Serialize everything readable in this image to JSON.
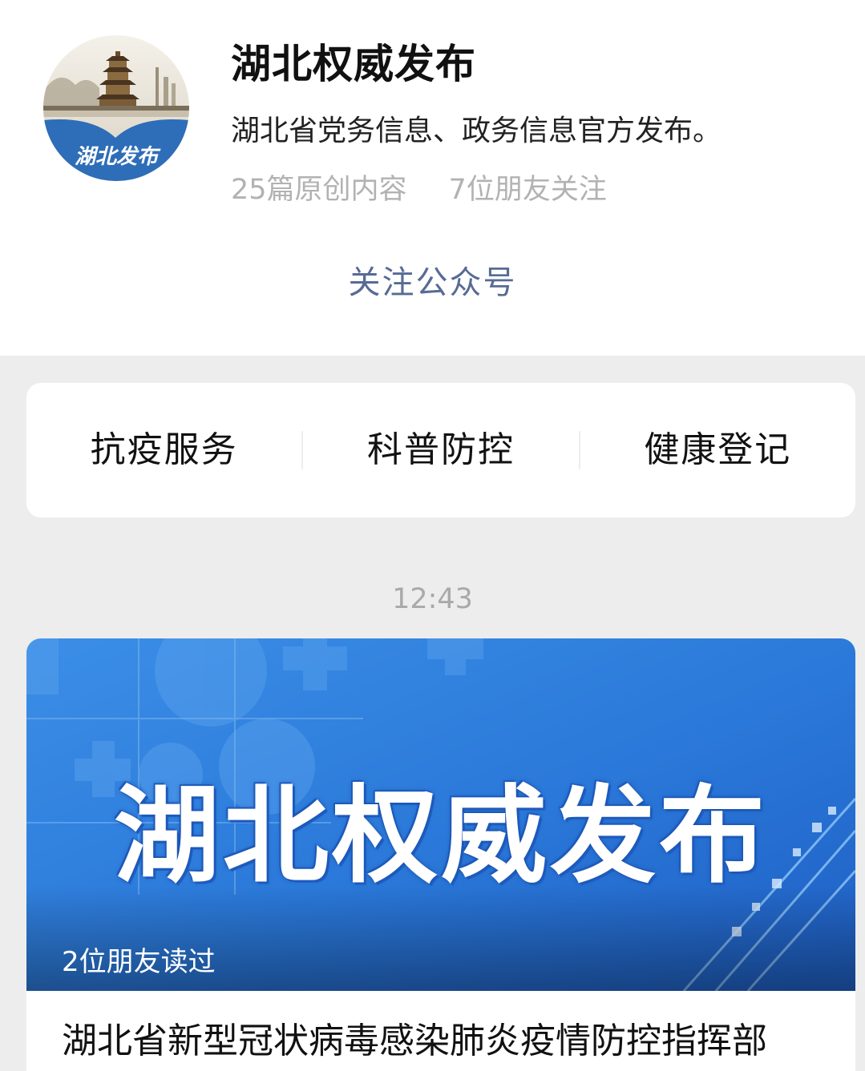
{
  "account": {
    "name": "湖北权威发布",
    "description": "湖北省党务信息、政务信息官方发布。",
    "stats": {
      "original_count": "25篇原创内容",
      "friends_following": "7位朋友关注"
    },
    "avatar_text": "湖北发布",
    "follow_label": "关注公众号"
  },
  "menu": {
    "items": [
      {
        "label": "抗疫服务"
      },
      {
        "label": "科普防控"
      },
      {
        "label": "健康登记"
      }
    ]
  },
  "timeline": {
    "timestamp": "12:43"
  },
  "article": {
    "cover_title": "湖北权威发布",
    "friends_read": "2位朋友读过",
    "title": "湖北省新型冠状病毒感染肺炎疫情防控指挥部"
  },
  "colors": {
    "link_blue": "#576b95",
    "cover_blue": "#2a7de0",
    "background": "#ededed"
  }
}
